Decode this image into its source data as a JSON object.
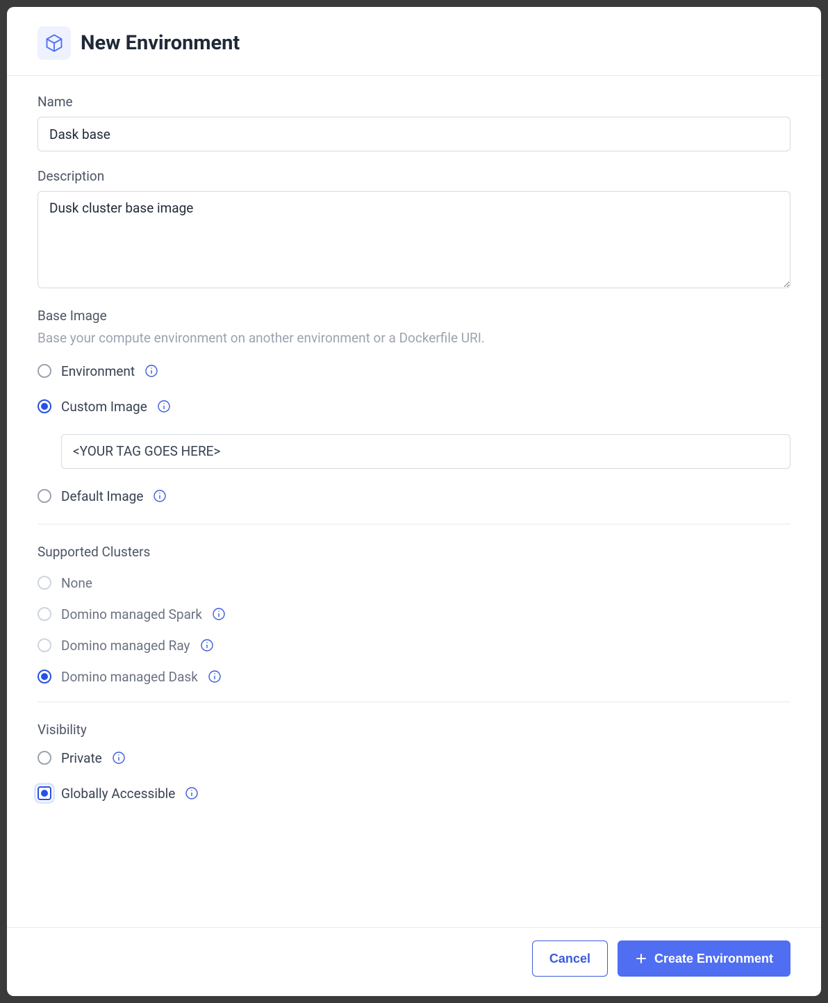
{
  "modal": {
    "title": "New Environment",
    "fields": {
      "name": {
        "label": "Name",
        "value": "Dask base"
      },
      "description": {
        "label": "Description",
        "value": "Dusk cluster base image"
      }
    },
    "base_image": {
      "label": "Base Image",
      "help": "Base your compute environment on another environment or a Dockerfile URI.",
      "options": {
        "environment": {
          "label": "Environment",
          "selected": false,
          "has_info": true
        },
        "custom_image": {
          "label": "Custom Image",
          "selected": true,
          "has_info": true,
          "value": "<YOUR TAG GOES HERE>"
        },
        "default_image": {
          "label": "Default Image",
          "selected": false,
          "has_info": true
        }
      }
    },
    "supported_clusters": {
      "label": "Supported Clusters",
      "options": [
        {
          "key": "none",
          "label": "None",
          "selected": false,
          "has_info": false
        },
        {
          "key": "spark",
          "label": "Domino managed Spark",
          "selected": false,
          "has_info": true
        },
        {
          "key": "ray",
          "label": "Domino managed Ray",
          "selected": false,
          "has_info": true
        },
        {
          "key": "dask",
          "label": "Domino managed Dask",
          "selected": true,
          "has_info": true
        }
      ]
    },
    "visibility": {
      "label": "Visibility",
      "options": [
        {
          "key": "private",
          "label": "Private",
          "selected": false,
          "has_info": true
        },
        {
          "key": "global",
          "label": "Globally Accessible",
          "selected": true,
          "has_info": true
        }
      ]
    },
    "footer": {
      "cancel": "Cancel",
      "submit": "Create Environment"
    }
  }
}
